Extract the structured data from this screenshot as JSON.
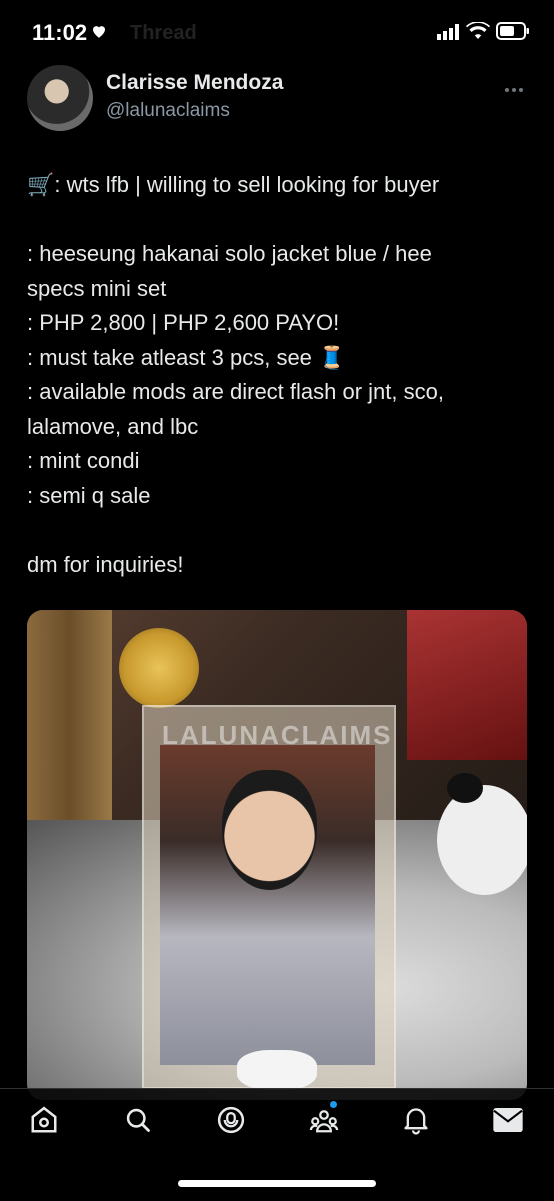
{
  "status_bar": {
    "time": "11:02",
    "faded_title": "Thread"
  },
  "author": {
    "display_name": "Clarisse Mendoza",
    "handle": "@lalunaclaims"
  },
  "tweet": {
    "lines": [
      "🛒: wts lfb | willing to sell looking for buyer",
      "",
      ": heeseung hakanai solo jacket blue / hee",
      "specs mini set",
      ": PHP 2,800 | PHP 2,600 PAYO!",
      ": must take atleast 3 pcs, see 🧵",
      ": available mods are direct flash or jnt, sco,",
      "lalamove, and lbc",
      ": mint condi",
      ": semi q sale",
      "",
      "dm for inquiries!"
    ]
  },
  "media": {
    "watermark": "LALUNACLAIMS"
  },
  "tab_bar": {
    "tabs": [
      "home-icon",
      "search-icon",
      "spaces-icon",
      "communities-icon",
      "notifications-icon",
      "messages-icon"
    ]
  },
  "colors": {
    "background": "#000000",
    "text": "#e7e9ea",
    "secondary": "#8b98a5",
    "accent": "#1d9bf0"
  }
}
